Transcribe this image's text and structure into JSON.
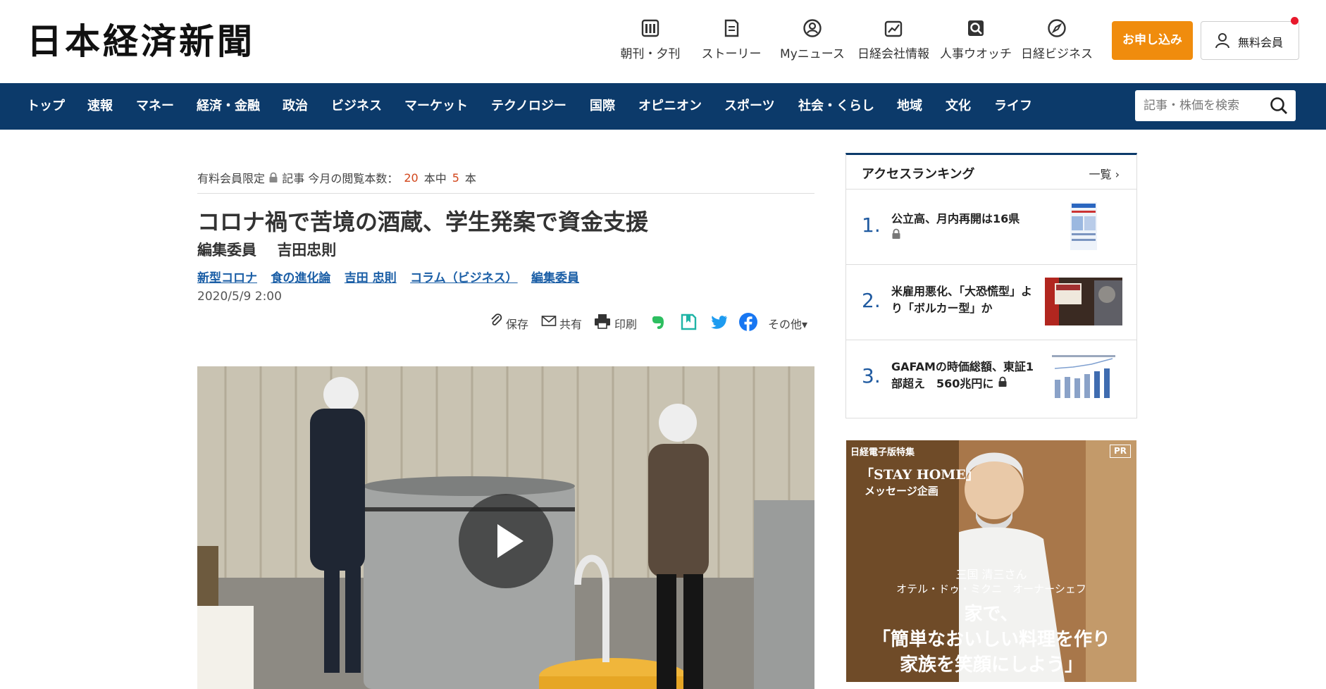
{
  "header": {
    "logo": "日本経済新聞",
    "nav": [
      {
        "label": "朝刊・夕刊",
        "icon": "newspaper-icon"
      },
      {
        "label": "ストーリー",
        "icon": "story-icon"
      },
      {
        "label": "Myニュース",
        "icon": "user-circle-icon"
      },
      {
        "label": "日経会社情報",
        "icon": "company-chart-icon"
      },
      {
        "label": "人事ウオッチ",
        "icon": "search-person-icon"
      },
      {
        "label": "日経ビジネス",
        "icon": "compass-icon"
      }
    ],
    "apply_label": "お申し込み",
    "member_label": "無料会員",
    "accent_color": "#f08c0d",
    "notification_color": "#e8192c"
  },
  "navbar": {
    "background": "#0c3a6a",
    "items": [
      "トップ",
      "速報",
      "マネー",
      "経済・金融",
      "政治",
      "ビジネス",
      "マーケット",
      "テクノロジー",
      "国際",
      "オピニオン",
      "スポーツ",
      "社会・くらし",
      "地域",
      "文化",
      "ライフ"
    ],
    "search_placeholder": "記事・株価を検索"
  },
  "article": {
    "meta": {
      "paid_label": "有料会員限定",
      "kind_label": "記事",
      "views_label": "今月の閲覧本数：",
      "views_total": "20",
      "views_mid": "本中",
      "views_read": "5",
      "views_unit": "本"
    },
    "title": "コロナ禍で苦境の酒蔵、学生発案で資金支援",
    "author_role": "編集委員",
    "author_name": "吉田忠則",
    "tags": [
      "新型コロナ",
      "食の進化論",
      "吉田 忠則",
      "コラム（ビジネス）",
      "編集委員"
    ],
    "date": "2020/5/9 2:00",
    "share": {
      "save": "保存",
      "share": "共有",
      "print": "印刷",
      "more": "その他▾"
    }
  },
  "ranking": {
    "title": "アクセスランキング",
    "more": "一覧 ›",
    "items": [
      {
        "rank": "1.",
        "text": "公立高、月内再開は16県",
        "locked": true
      },
      {
        "rank": "2.",
        "text": "米雇用悪化、「大恐慌型」より「ボルカー型」か",
        "locked": false
      },
      {
        "rank": "3.",
        "text": "GAFAMの時価総額、東証1部超え　560兆円に",
        "locked": true
      }
    ]
  },
  "ad": {
    "sponsor": "日経電子版特集",
    "pr": "PR",
    "campaign": "「STAY HOME」",
    "sub": "メッセージ企画",
    "person": "三国 清三さん",
    "role": "オテル・ドゥ・ミクニ　オーナーシェフ",
    "copy1": "家で、",
    "copy2": "「簡単なおいしい料理を作り",
    "copy3": "家族を笑顔にしよう」"
  }
}
